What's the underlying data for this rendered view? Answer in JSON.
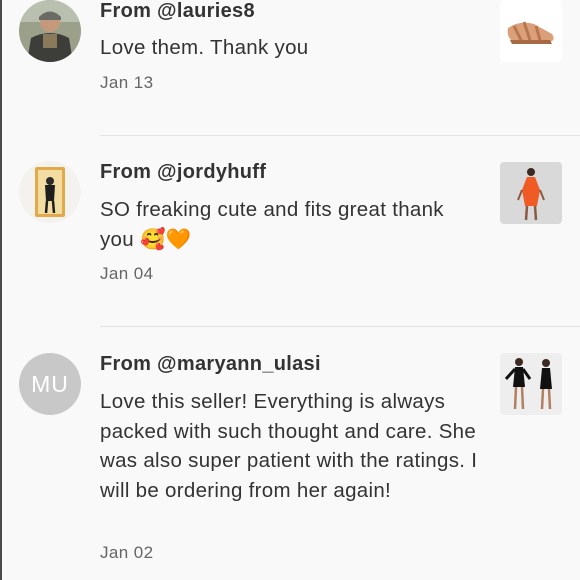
{
  "reviews": [
    {
      "from": "From @lauries8",
      "comment": "Love them. Thank you",
      "date": "Jan 13",
      "avatar_icon": "user-photo-icon",
      "product_icon": "sandal-product-icon"
    },
    {
      "from": "From @jordyhuff",
      "comment": "SO freaking cute and fits great thank you 🥰🧡",
      "date": "Jan 04",
      "avatar_icon": "user-photo-icon",
      "product_icon": "orange-dress-product-icon"
    },
    {
      "from": "From @maryann_ulasi",
      "comment": "Love this seller! Everything is always packed with such thought and care. She was also super patient with the ratings. I will be ordering from her again!",
      "date": "Jan 02",
      "avatar_initials": "MU",
      "product_icon": "black-outfit-product-icon"
    }
  ],
  "colors": {
    "background": "#faf9fa",
    "text": "#333333",
    "date_text": "#666666",
    "divider": "#e4e2e4",
    "initials_avatar_bg": "#c8c8c8"
  }
}
